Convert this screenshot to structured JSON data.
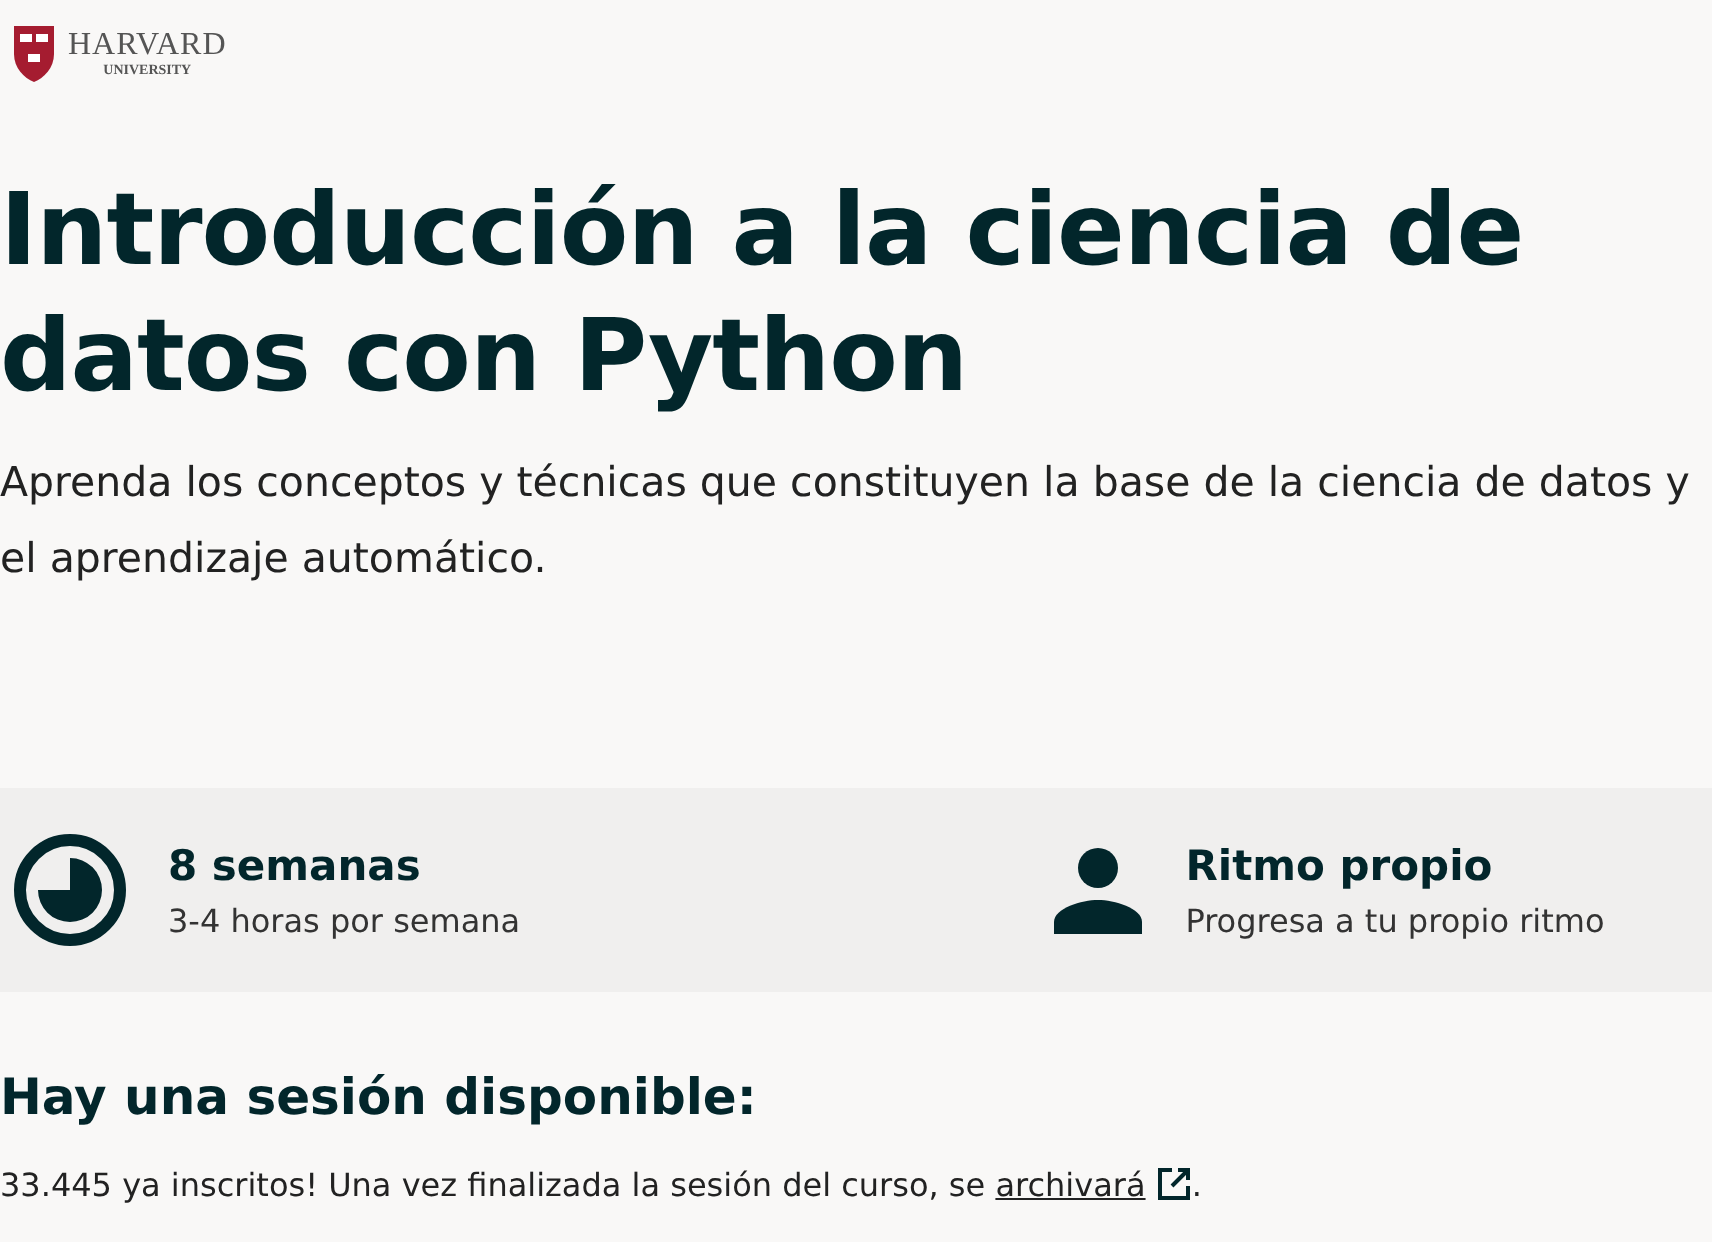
{
  "logo": {
    "name": "HARVARD",
    "subtitle": "UNIVERSITY"
  },
  "course": {
    "title": "Introducción a la ciencia de datos con Python",
    "description": "Aprenda los conceptos y técnicas que constituyen la base de la ciencia de datos y el aprendizaje automático."
  },
  "facts": [
    {
      "kind": "duration",
      "title": "8 semanas",
      "detail": "3-4 horas por semana"
    },
    {
      "kind": "pace",
      "title": "Ritmo propio",
      "detail": "Progresa a tu propio ritmo"
    }
  ],
  "session": {
    "heading": "Hay una sesión disponible:",
    "text": "33.445 ya inscritos! Una vez finalizada la sesión del curso, se ",
    "link": "archivará",
    "end": "."
  }
}
